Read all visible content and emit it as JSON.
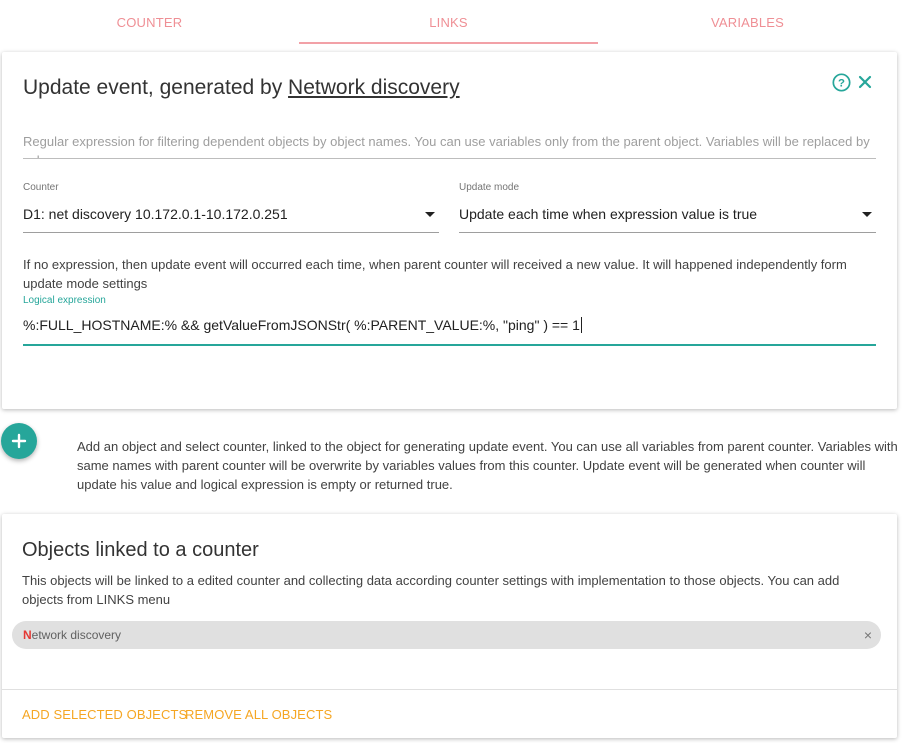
{
  "tabs": [
    {
      "label": "COUNTER"
    },
    {
      "label": "LINKS",
      "active": true
    },
    {
      "label": "VARIABLES"
    }
  ],
  "update_event": {
    "title_prefix": "Update event, generated by",
    "title_link": "Network discovery",
    "regex_placeholder": "Regular expression for filtering dependent objects by object names. You can use variables only from the parent object. Variables will be replaced by values.",
    "counter_label": "Counter",
    "counter_value": "D1: net discovery 10.172.0.1-10.172.0.251",
    "update_mode_label": "Update mode",
    "update_mode_value": "Update each time when expression value is true",
    "help_text": "If no expression, then update event will occurred each time, when parent counter will received a new value. It will happened independently form update mode settings",
    "logical_expression_label": "Logical expression",
    "logical_expression_value": "%:FULL_HOSTNAME:% && getValueFromJSONStr( %:PARENT_VALUE:%, \"ping\" ) == 1"
  },
  "add_hint": "Add an object and select counter, linked to the object for generating update event. You can use all variables from parent counter. Variables with same names with parent counter will be overwrite by variables values from this counter. Update event will be generated when counter will update his value and logical expression is empty or returned true.",
  "objects_card": {
    "title": "Objects linked to a counter",
    "description": "This objects will be linked to a edited counter and collecting data according counter settings with implementation to those objects. You can add objects from LINKS menu",
    "chip_first_letter": "N",
    "chip_rest": "etwork discovery",
    "chip_close": "×",
    "add_selected_label": "ADD SELECTED OBJECTS",
    "remove_all_label": "REMOVE ALL OBJECTS"
  },
  "colors": {
    "accent": "#26a69a",
    "tab_text": "#ef8f95",
    "action_text": "#f5a623"
  },
  "icons": {
    "help": "help-circle-icon",
    "close": "close-icon",
    "add": "plus-icon",
    "dropdown": "caret-down-icon"
  }
}
